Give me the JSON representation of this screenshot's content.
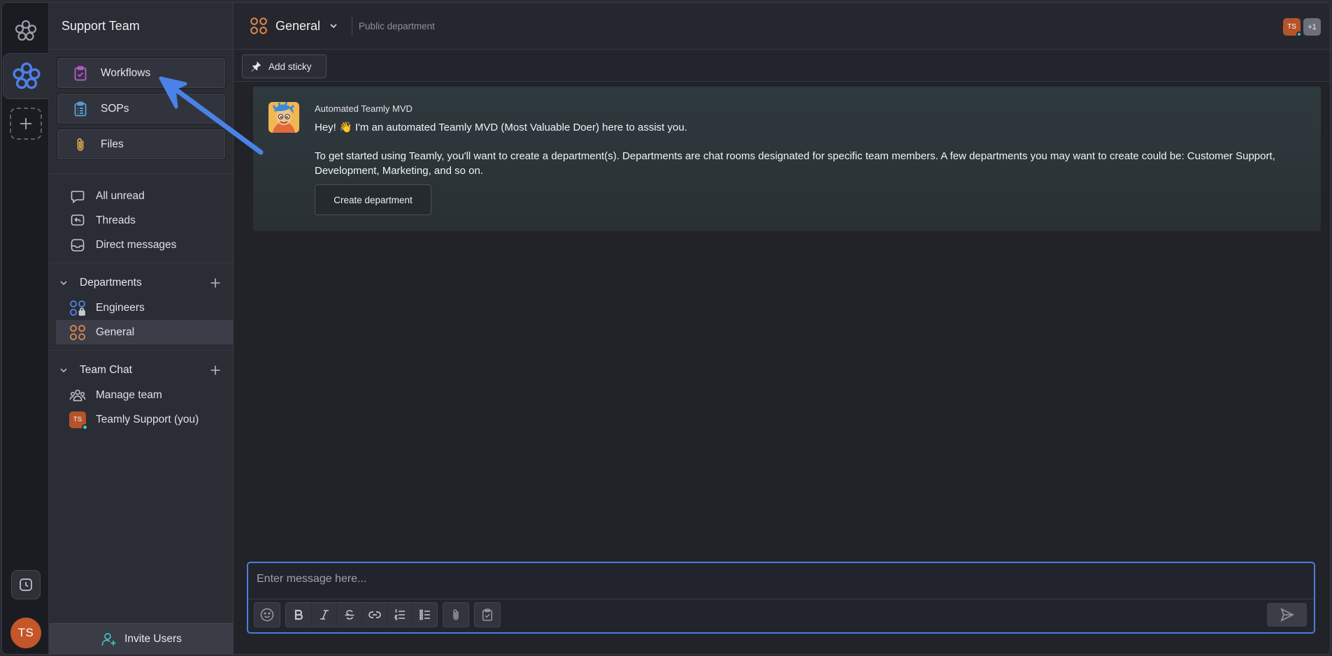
{
  "workspace": {
    "name": "Support Team",
    "user_initials": "TS"
  },
  "quick_links": [
    {
      "label": "Workflows",
      "icon": "clipboard-check-icon",
      "color": "#c15ad6"
    },
    {
      "label": "SOPs",
      "icon": "clipboard-list-icon",
      "color": "#5aa5e0"
    },
    {
      "label": "Files",
      "icon": "paperclip-icon",
      "color": "#e3a94e"
    }
  ],
  "nav": [
    {
      "label": "All unread",
      "icon": "message-icon"
    },
    {
      "label": "Threads",
      "icon": "threads-icon"
    },
    {
      "label": "Direct messages",
      "icon": "inbox-icon"
    }
  ],
  "departments": {
    "title": "Departments",
    "items": [
      {
        "label": "Engineers",
        "icon": "private-department-icon",
        "color": "#4f86e8"
      },
      {
        "label": "General",
        "icon": "department-icon",
        "color": "#e08a4c"
      }
    ]
  },
  "team_chat": {
    "title": "Team Chat",
    "items": [
      {
        "label": "Manage team",
        "icon": "team-icon"
      },
      {
        "label": "Teamly Support (you)",
        "avatar": "TS"
      }
    ]
  },
  "invite_label": "Invite Users",
  "header": {
    "department": "General",
    "type": "Public department",
    "member_initials": "TS",
    "extra_members": "+1"
  },
  "sticky_label": "Add sticky",
  "message": {
    "author": "Automated Teamly MVD",
    "line1": "Hey! 👋 I'm an automated Teamly MVD (Most Valuable Doer) here to assist you.",
    "line2": "To get started using Teamly, you'll want to create a department(s). Departments are chat rooms designated for specific team members. A few departments you may want to create could be: Customer Support, Development, Marketing, and so on.",
    "button": "Create department"
  },
  "composer": {
    "placeholder": "Enter message here..."
  },
  "colors": {
    "accent": "#4a7de0",
    "orange": "#e08a4c",
    "online": "#43c4c0",
    "annotation_arrow": "#4a82e8"
  }
}
